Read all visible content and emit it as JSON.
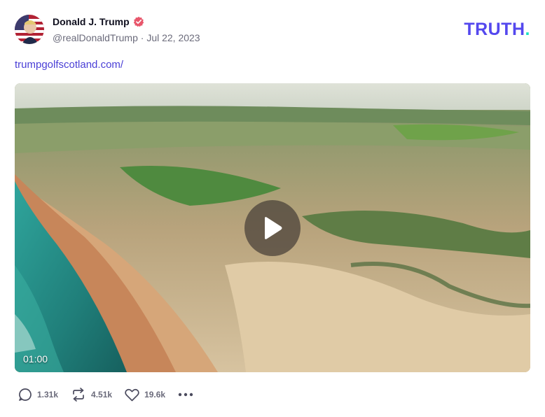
{
  "post": {
    "author_name": "Donald J. Trump",
    "handle": "@realDonaldTrump",
    "separator": "·",
    "date": "Jul 22, 2023",
    "link_text": "trumpgolfscotland.com/"
  },
  "brand": {
    "logo_text": "TRUTH",
    "logo_dot": ".",
    "logo_color": "#5448ee",
    "dot_color": "#17e3c2"
  },
  "video": {
    "duration": "01:00"
  },
  "actions": {
    "replies": "1.31k",
    "reposts": "4.51k",
    "likes": "19.6k"
  },
  "icons": {
    "verified": "verified-badge-icon",
    "reply": "reply-bubble-icon",
    "repost": "repost-arrows-icon",
    "like": "heart-icon",
    "more": "more-dots-icon",
    "play": "play-icon"
  }
}
